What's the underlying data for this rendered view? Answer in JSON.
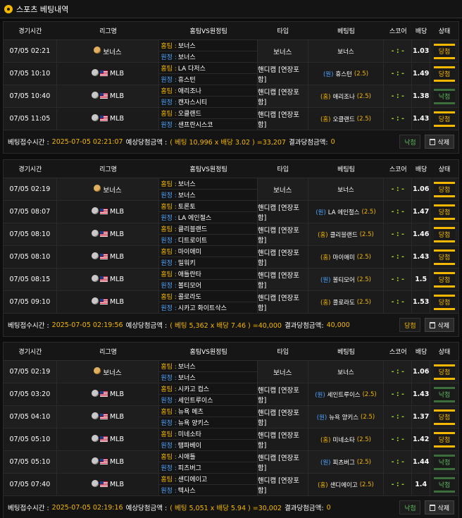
{
  "page": {
    "title": "스포츠 베팅내역"
  },
  "columns": {
    "time": "경기시간",
    "league": "리그명",
    "match": "홈팀VS원정팀",
    "type": "타입",
    "team": "베팅팀",
    "score": "스코어",
    "odds": "배당",
    "state": "상태"
  },
  "labels": {
    "home": "홈팀 :",
    "away": "원정 :",
    "delete": "삭제",
    "receipt_time": "베팅접수시간 :",
    "expected": "예상당첨금액 :",
    "result": "결과당첨금액:"
  },
  "slips": [
    {
      "rows": [
        {
          "time": "07/05 02:21",
          "league": "보너스",
          "sport": "bonus",
          "home": "보너스",
          "away": "보너스",
          "type": "보너스",
          "pick_prefix": "",
          "pick_side": "",
          "pick_team": "보너스",
          "handicap": "",
          "score": "- : -",
          "odds": "1.03",
          "state": "당첨"
        },
        {
          "time": "07/05 10:10",
          "league": "MLB",
          "sport": "baseball",
          "home": "LA 다저스",
          "away": "휴스턴",
          "type": "핸디캡 [연장포함]",
          "pick_prefix": "(원)",
          "pick_side": "away",
          "pick_team": "휴스턴",
          "handicap": "(2.5)",
          "score": "- : -",
          "odds": "1.49",
          "state": "당첨"
        },
        {
          "time": "07/05 10:40",
          "league": "MLB",
          "sport": "baseball",
          "home": "애리조나",
          "away": "캔자스시티",
          "type": "핸디캡 [연장포함]",
          "pick_prefix": "(홈)",
          "pick_side": "home",
          "pick_team": "애리조나",
          "handicap": "(2.5)",
          "score": "- : -",
          "odds": "1.38",
          "state": "낙첨"
        },
        {
          "time": "07/05 11:05",
          "league": "MLB",
          "sport": "baseball",
          "home": "오클랜드",
          "away": "샌프란시스코",
          "type": "핸디캡 [연장포함]",
          "pick_prefix": "(홈)",
          "pick_side": "home",
          "pick_team": "오클랜드",
          "handicap": "(2.5)",
          "score": "- : -",
          "odds": "1.43",
          "state": "당첨"
        }
      ],
      "receipt_time": "2025-07-05 02:21:07",
      "expected": "( 베팅 10,996 x 배당 3.02 ) =33,207",
      "result": "0",
      "overall": "낙첨"
    },
    {
      "rows": [
        {
          "time": "07/05 02:19",
          "league": "보너스",
          "sport": "bonus",
          "home": "보너스",
          "away": "보너스",
          "type": "보너스",
          "pick_prefix": "",
          "pick_side": "",
          "pick_team": "보너스",
          "handicap": "",
          "score": "- : -",
          "odds": "1.06",
          "state": "당첨"
        },
        {
          "time": "07/05 08:07",
          "league": "MLB",
          "sport": "baseball",
          "home": "토론토",
          "away": "LA 에인절스",
          "type": "핸디캡 [연장포함]",
          "pick_prefix": "(원)",
          "pick_side": "away",
          "pick_team": "LA 에인절스",
          "handicap": "(2.5)",
          "score": "- : -",
          "odds": "1.47",
          "state": "당첨"
        },
        {
          "time": "07/05 08:10",
          "league": "MLB",
          "sport": "baseball",
          "home": "클리블랜드",
          "away": "디트로이트",
          "type": "핸디캡 [연장포함]",
          "pick_prefix": "(홈)",
          "pick_side": "home",
          "pick_team": "클리블랜드",
          "handicap": "(2.5)",
          "score": "- : -",
          "odds": "1.46",
          "state": "당첨"
        },
        {
          "time": "07/05 08:10",
          "league": "MLB",
          "sport": "baseball",
          "home": "마이애미",
          "away": "밀워키",
          "type": "핸디캡 [연장포함]",
          "pick_prefix": "(홈)",
          "pick_side": "home",
          "pick_team": "마이애미",
          "handicap": "(2.5)",
          "score": "- : -",
          "odds": "1.43",
          "state": "당첨"
        },
        {
          "time": "07/05 08:15",
          "league": "MLB",
          "sport": "baseball",
          "home": "애틀란타",
          "away": "볼티모어",
          "type": "핸디캡 [연장포함]",
          "pick_prefix": "(원)",
          "pick_side": "away",
          "pick_team": "볼티모어",
          "handicap": "(2.5)",
          "score": "- : -",
          "odds": "1.5",
          "state": "당첨"
        },
        {
          "time": "07/05 09:10",
          "league": "MLB",
          "sport": "baseball",
          "home": "콜로라도",
          "away": "시카고 화이트삭스",
          "type": "핸디캡 [연장포함]",
          "pick_prefix": "(홈)",
          "pick_side": "home",
          "pick_team": "콜로라도",
          "handicap": "(2.5)",
          "score": "- : -",
          "odds": "1.53",
          "state": "당첨"
        }
      ],
      "receipt_time": "2025-07-05 02:19:56",
      "expected": "( 베팅 5,362 x 배당 7.46 ) =40,000",
      "result": "40,000",
      "overall": "당첨"
    },
    {
      "rows": [
        {
          "time": "07/05 02:19",
          "league": "보너스",
          "sport": "bonus",
          "home": "보너스",
          "away": "보너스",
          "type": "보너스",
          "pick_prefix": "",
          "pick_side": "",
          "pick_team": "보너스",
          "handicap": "",
          "score": "- : -",
          "odds": "1.06",
          "state": "당첨"
        },
        {
          "time": "07/05 03:20",
          "league": "MLB",
          "sport": "baseball",
          "home": "시카고 컵스",
          "away": "세인트루이스",
          "type": "핸디캡 [연장포함]",
          "pick_prefix": "(원)",
          "pick_side": "away",
          "pick_team": "세인트루이스",
          "handicap": "(2.5)",
          "score": "- : -",
          "odds": "1.43",
          "state": "낙첨"
        },
        {
          "time": "07/05 04:10",
          "league": "MLB",
          "sport": "baseball",
          "home": "뉴욕 메츠",
          "away": "뉴욕 양키스",
          "type": "핸디캡 [연장포함]",
          "pick_prefix": "(원)",
          "pick_side": "away",
          "pick_team": "뉴욕 양키스",
          "handicap": "(2.5)",
          "score": "- : -",
          "odds": "1.37",
          "state": "당첨"
        },
        {
          "time": "07/05 05:10",
          "league": "MLB",
          "sport": "baseball",
          "home": "미네소타",
          "away": "탬파베이",
          "type": "핸디캡 [연장포함]",
          "pick_prefix": "(홈)",
          "pick_side": "home",
          "pick_team": "미네소타",
          "handicap": "(2.5)",
          "score": "- : -",
          "odds": "1.42",
          "state": "당첨"
        },
        {
          "time": "07/05 05:10",
          "league": "MLB",
          "sport": "baseball",
          "home": "시애틀",
          "away": "피츠버그",
          "type": "핸디캡 [연장포함]",
          "pick_prefix": "(원)",
          "pick_side": "away",
          "pick_team": "피츠버그",
          "handicap": "(2.5)",
          "score": "- : -",
          "odds": "1.44",
          "state": "낙첨"
        },
        {
          "time": "07/05 07:40",
          "league": "MLB",
          "sport": "baseball",
          "home": "샌디에이고",
          "away": "텍사스",
          "type": "핸디캡 [연장포함]",
          "pick_prefix": "(홈)",
          "pick_side": "home",
          "pick_team": "샌디에이고",
          "handicap": "(2.5)",
          "score": "- : -",
          "odds": "1.4",
          "state": "낙첨"
        }
      ],
      "receipt_time": "2025-07-05 02:19:16",
      "expected": "( 베팅 5,051 x 배당 5.94 ) =30,002",
      "result": "0",
      "overall": "낙첨"
    }
  ],
  "colors": {
    "accent": "#f5b800",
    "home": "#f5b800",
    "away": "#4da3ff",
    "lose": "#5cb85c"
  }
}
